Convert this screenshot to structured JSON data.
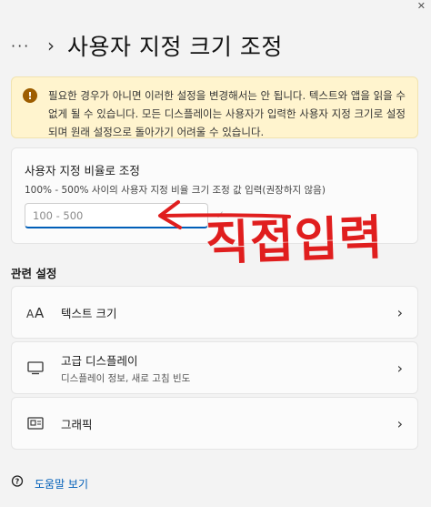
{
  "header": {
    "more_label": "···",
    "title": "사용자 지정 크기 조정"
  },
  "warning": {
    "text": "필요한 경우가 아니면 이러한 설정을 변경해서는 안 됩니다. 텍스트와 앱을 읽을 수 없게 될 수 있습니다. 모든 디스플레이는 사용자가 입력한 사용자 지정 크기로 설정되며 원래 설정으로 돌아가기 어려울 수 있습니다."
  },
  "scale": {
    "title": "사용자 지정 비율로 조정",
    "description": "100% - 500% 사이의 사용자 지정 비율 크기 조정 값 입력(권장하지 않음)",
    "placeholder": "100 - 500"
  },
  "related": {
    "title": "관련 설정",
    "items": [
      {
        "icon": "text-size-icon",
        "label": "텍스트 크기",
        "sub": ""
      },
      {
        "icon": "monitor-icon",
        "label": "고급 디스플레이",
        "sub": "디스플레이 정보, 새로 고침 빈도"
      },
      {
        "icon": "graphics-card-icon",
        "label": "그래픽",
        "sub": ""
      }
    ]
  },
  "help": {
    "label": "도움말 보기"
  },
  "annotation": {
    "text": "직접입력",
    "color": "#e01e1e"
  },
  "colors": {
    "accent": "#005fb8",
    "warning_bg": "#fff4ce",
    "warning_icon": "#9d5d00"
  }
}
